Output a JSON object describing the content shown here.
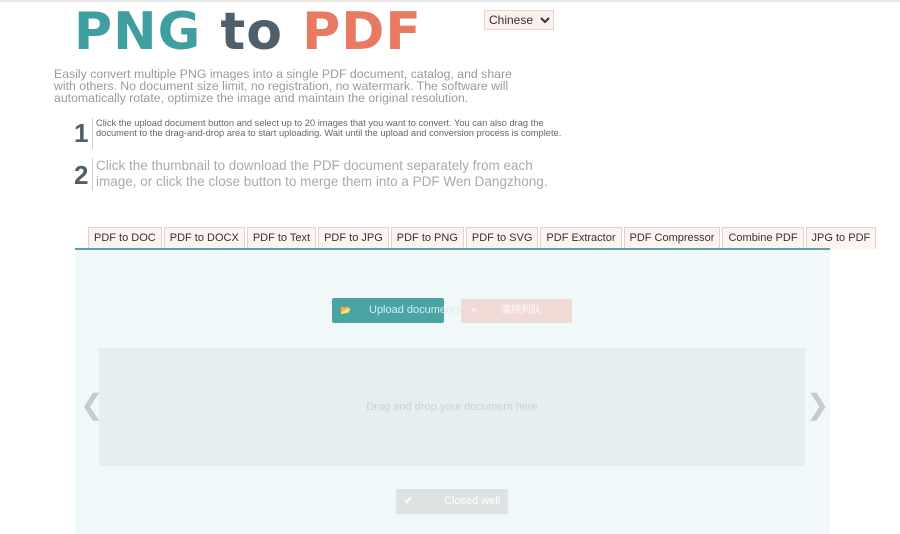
{
  "logo": {
    "part1": "PNG",
    "part2": "to",
    "part3": "PDF"
  },
  "language": {
    "selected": "Chinese"
  },
  "intro": "Easily convert multiple PNG images into a single PDF document, catalog, and share with others. No document size limit, no registration, no watermark. The software will automatically rotate, optimize the image and maintain the original resolution.",
  "steps": [
    {
      "num": "1",
      "text": "Click the upload document button and select up to 20 images that you want to convert. You can also drag the document to the drag-and-drop area to start uploading. Wait until the upload and conversion process is complete."
    },
    {
      "num": "2",
      "text": "Click the thumbnail to download the PDF document separately from each image, or click the close button to merge them into a PDF Wen Dangzhong."
    }
  ],
  "tabs": [
    "PDF to DOC",
    "PDF to DOCX",
    "PDF to Text",
    "PDF to JPG",
    "PDF to PNG",
    "PDF to SVG",
    "PDF Extractor",
    "PDF Compressor",
    "Combine PDF",
    "JPG to PDF"
  ],
  "panel": {
    "upload_label": "Upload documents",
    "clear_label": "清除列队",
    "drop_text": "Drag and drop your document here",
    "prev": "❮",
    "next": "❯",
    "closed_label": "Closed well"
  },
  "colors": {
    "teal": "#3f9fa0",
    "slate": "#4f5f6b",
    "coral": "#e87a62"
  }
}
